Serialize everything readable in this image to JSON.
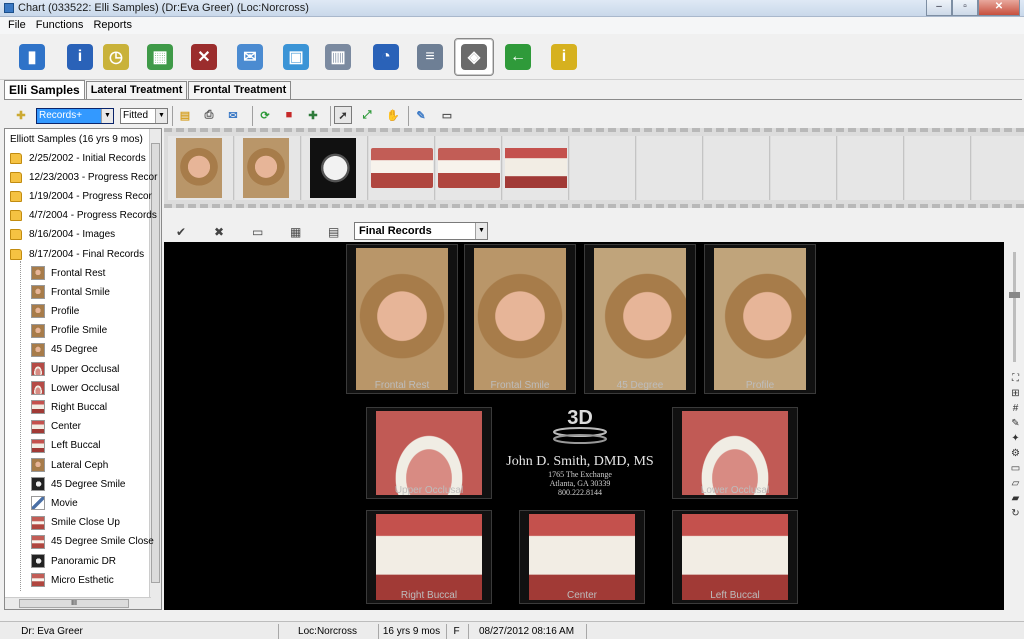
{
  "window": {
    "title": "Chart (033522: Elli Samples) (Dr:Eva Greer) (Loc:Norcross)",
    "controls": [
      "–",
      "▫",
      "✕"
    ]
  },
  "menu": [
    "File",
    "Functions",
    "Reports"
  ],
  "big_toolbar": [
    {
      "icon": "door-exit-icon",
      "glyph": "▮",
      "color": "#2f73c8"
    },
    {
      "icon": "person-info-icon",
      "glyph": "i",
      "color": "#2a62b8"
    },
    {
      "icon": "clock-note-icon",
      "glyph": "◷",
      "color": "#c9b23a"
    },
    {
      "icon": "calculator-icon",
      "glyph": "▦",
      "color": "#3f9a48"
    },
    {
      "icon": "tooth-cancel-icon",
      "glyph": "✕",
      "color": "#9b2d2d"
    },
    {
      "icon": "mail-document-icon",
      "glyph": "✉",
      "color": "#4b8bd1"
    },
    {
      "icon": "picture-frame-icon",
      "glyph": "▣",
      "color": "#3b94d6"
    },
    {
      "icon": "calendar-grid-icon",
      "glyph": "▥",
      "color": "#7b8aa0"
    },
    {
      "icon": "person-clock-icon",
      "glyph": "◔",
      "color": "#2a62b8"
    },
    {
      "icon": "database-icon",
      "glyph": "≡",
      "color": "#6e7f95"
    },
    {
      "icon": "image-viewer-icon",
      "glyph": "◈",
      "color": "#6a6a6a"
    },
    {
      "icon": "back-arrow-icon",
      "glyph": "←",
      "color": "#2f9a3a"
    },
    {
      "icon": "info-document-icon",
      "glyph": "i",
      "color": "#d6b11f"
    }
  ],
  "tabs": [
    "Elli Samples",
    "Lateral Treatment",
    "Frontal Treatment"
  ],
  "small_toolbar": {
    "record_type": "Records+",
    "fit_mode": "Fitted",
    "icons": [
      "new-document-icon",
      "folder-image-icon",
      "print-icon",
      "email-icon",
      "refresh-icon",
      "toolbox-icon",
      "add-image-icon",
      "select-pointer-icon",
      "fit-expand-icon",
      "hand-pan-icon",
      "pencil-edit-icon",
      "presentation-icon"
    ]
  },
  "tree": {
    "root": "Elliott  Samples (16 yrs 9 mos)",
    "records": [
      "2/25/2002 - Initial Records",
      "12/23/2003 - Progress Recor",
      "1/19/2004 - Progress Recor",
      "4/7/2004 - Progress Records",
      "8/16/2004 - Images",
      "8/17/2004 - Final Records"
    ],
    "images": [
      {
        "label": "Frontal Rest",
        "kind": "face"
      },
      {
        "label": "Frontal Smile",
        "kind": "face"
      },
      {
        "label": "Profile",
        "kind": "face"
      },
      {
        "label": "Profile Smile",
        "kind": "face"
      },
      {
        "label": "45 Degree",
        "kind": "face"
      },
      {
        "label": "Upper Occlusal",
        "kind": "occlusal"
      },
      {
        "label": "Lower Occlusal",
        "kind": "occlusal"
      },
      {
        "label": "Right Buccal",
        "kind": "teeth"
      },
      {
        "label": "Center",
        "kind": "teeth"
      },
      {
        "label": "Left Buccal",
        "kind": "teeth"
      },
      {
        "label": "Lateral Ceph",
        "kind": "face"
      },
      {
        "label": "45 Degree Smile",
        "kind": "xray"
      },
      {
        "label": "Movie",
        "kind": "movie"
      },
      {
        "label": "Smile Close Up",
        "kind": "smile"
      },
      {
        "label": "45 Degree Smile Close",
        "kind": "smile"
      },
      {
        "label": "Panoramic DR",
        "kind": "xray"
      },
      {
        "label": "Micro Esthetic",
        "kind": "smile"
      }
    ],
    "hscroll_label": "III"
  },
  "filmstrip": [
    "face",
    "face",
    "xray",
    "smile",
    "smile",
    "teeth"
  ],
  "viewer": {
    "selected_set": "Final Records",
    "tool_icons": [
      "checkmark-icon",
      "delete-x-icon",
      "folder-icon",
      "grid-layout-icon",
      "template-icon"
    ],
    "tool_glyphs": [
      "✔",
      "✖",
      "▭",
      "▦",
      "▤"
    ],
    "captions": {
      "frontal_rest": "Frontal Rest",
      "frontal_smile": "Frontal Smile",
      "degree45": "45 Degree",
      "profile": "Profile",
      "upper_occlusal": "Upper Occlusal",
      "lower_occlusal": "Lower Occlusal",
      "right_buccal": "Right Buccal",
      "center": "Center",
      "left_buccal": "Left Buccal"
    },
    "logo_text": "3D",
    "doctor": {
      "name": "John D. Smith, DMD, MS",
      "address1": "1765 The Exchange",
      "address2": "Atlanta, GA 30339",
      "phone": "800.222.8144"
    }
  },
  "right_tools": [
    "⛶",
    "⊞",
    "#",
    "✎",
    "✦",
    "⚙",
    "▭",
    "▱",
    "▰",
    "↻"
  ],
  "status": {
    "doctor": "Dr: Eva Greer",
    "location": "Loc:Norcross",
    "age": "16 yrs 9 mos",
    "sex": "F",
    "datetime": "08/27/2012 08:16 AM"
  }
}
